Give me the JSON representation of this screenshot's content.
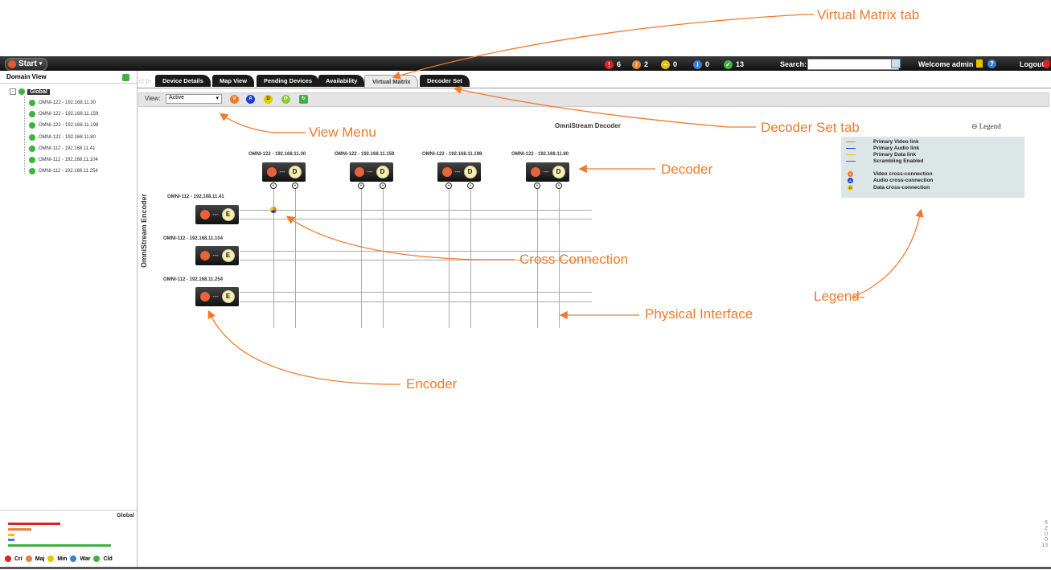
{
  "topbar": {
    "start_label": "Start",
    "alarms": [
      {
        "icon": "critical-icon",
        "count": "6",
        "color": "#d22"
      },
      {
        "icon": "major-icon",
        "count": "2",
        "color": "#e8823a"
      },
      {
        "icon": "minor-icon",
        "count": "0",
        "color": "#e8c400"
      },
      {
        "icon": "warning-icon",
        "count": "0",
        "color": "#3a7fd8"
      },
      {
        "icon": "cleared-icon",
        "count": "13",
        "color": "#3cb43c"
      }
    ],
    "search_label": "Search:",
    "welcome": "Welcome admin",
    "logout": "Logout"
  },
  "sidebar": {
    "title": "Domain View",
    "root": "Global",
    "items": [
      "OMNI-122 - 192.168.11.30",
      "OMNI-122 - 192.168.11.159",
      "OMNI-122 - 192.168.11.198",
      "OMNI-122 - 192.168.11.80",
      "OMNI-112 - 192.168.11.41",
      "OMNI-112 - 192.168.11.104",
      "OMNI-112 - 192.168.11.254"
    ],
    "summary": {
      "title": "Global",
      "counts": [
        "6",
        "2",
        "0",
        "0",
        "13"
      ],
      "legend": [
        "Cri",
        "Maj",
        "Min",
        "War",
        "Cld"
      ]
    }
  },
  "tabs": [
    "Device Details",
    "Map View",
    "Pending Devices",
    "Availability",
    "Virtual Matrix",
    "Decoder Set"
  ],
  "active_tab": "Virtual Matrix",
  "viewbar": {
    "label": "View:",
    "selected": "Active",
    "icons": [
      "V",
      "A",
      "D"
    ]
  },
  "matrix": {
    "decoder_title": "OmniStream Decoder",
    "encoder_title": "OmniStream Encoder",
    "decoders": [
      "OMNI-122 - 192.168.11.30",
      "OMNI-122 - 192.168.11.159",
      "OMNI-122 - 192.168.11.198",
      "OMNI-122 - 192.168.11.80"
    ],
    "encoders": [
      "OMNI-112 - 192.168.11.41",
      "OMNI-112 - 192.168.11.104",
      "OMNI-112 - 192.168.11.254"
    ],
    "decoder_letter": "D",
    "encoder_letter": "E",
    "box_dash": "---"
  },
  "legend": {
    "toggle": "⊖ Legend",
    "items": [
      {
        "label": "Primary Video link",
        "color": "#f07a2a",
        "kind": "line"
      },
      {
        "label": "Primary Audio link",
        "color": "#1a3cd8",
        "kind": "line"
      },
      {
        "label": "Primary Data link",
        "color": "#e6c800",
        "kind": "line"
      },
      {
        "label": "Scrambling Enabled",
        "color": "#a020d0",
        "kind": "line"
      },
      {
        "label": "Video cross-connection",
        "color": "#f07a2a",
        "kind": "dot",
        "letter": "V"
      },
      {
        "label": "Audio cross-connection",
        "color": "#1a3cd8",
        "kind": "dot",
        "letter": "A"
      },
      {
        "label": "Data cross-connection",
        "color": "#e6c800",
        "kind": "dot",
        "letter": "D"
      }
    ]
  },
  "annotations": {
    "virtual_matrix_tab": "Virtual Matrix tab",
    "view_menu": "View Menu",
    "decoder_set_tab": "Decoder Set tab",
    "decoder": "Decoder",
    "cross_connection": "Cross Connection",
    "legend": "Legend",
    "physical_interface": "Physical Interface",
    "encoder": "Encoder"
  }
}
